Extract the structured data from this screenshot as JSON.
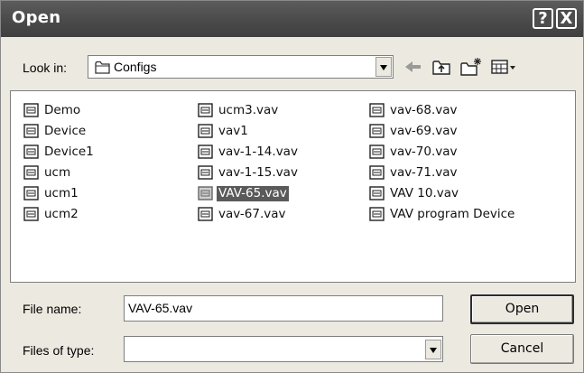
{
  "dialog": {
    "title": "Open",
    "help_glyph": "?",
    "close_glyph": "X"
  },
  "look_in": {
    "label": "Look in:",
    "value": "Configs",
    "icon": "folder-icon"
  },
  "toolbar": {
    "icons": [
      "back-arrow-icon",
      "up-one-level-icon",
      "new-folder-icon",
      "view-menu-icon"
    ]
  },
  "files": [
    {
      "name": "Demo",
      "selected": false
    },
    {
      "name": "Device",
      "selected": false
    },
    {
      "name": "Device1",
      "selected": false
    },
    {
      "name": "ucm",
      "selected": false
    },
    {
      "name": "ucm1",
      "selected": false
    },
    {
      "name": "ucm2",
      "selected": false
    },
    {
      "name": "ucm3.vav",
      "selected": false
    },
    {
      "name": "vav1",
      "selected": false
    },
    {
      "name": "vav-1-14.vav",
      "selected": false
    },
    {
      "name": "vav-1-15.vav",
      "selected": false
    },
    {
      "name": "VAV-65.vav",
      "selected": true
    },
    {
      "name": "vav-67.vav",
      "selected": false
    },
    {
      "name": "vav-68.vav",
      "selected": false
    },
    {
      "name": "vav-69.vav",
      "selected": false
    },
    {
      "name": "vav-70.vav",
      "selected": false
    },
    {
      "name": "vav-71.vav",
      "selected": false
    },
    {
      "name": "VAV 10.vav",
      "selected": false
    },
    {
      "name": "VAV program Device",
      "selected": false
    }
  ],
  "file_name": {
    "label": "File name:",
    "value": "VAV-65.vav"
  },
  "file_type": {
    "label": "Files of type:",
    "value": ""
  },
  "buttons": {
    "open": "Open",
    "cancel": "Cancel"
  },
  "colors": {
    "selection": "#5a5a5a",
    "titlebar": "#4a4a4a",
    "dialog_bg": "#ece9e0"
  }
}
